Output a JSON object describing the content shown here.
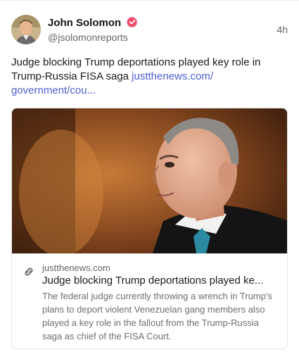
{
  "author": {
    "display_name": "John Solomon",
    "handle": "@jsolomonreports",
    "verified": true,
    "avatar_icon": "avatar-photo"
  },
  "post": {
    "timestamp": "4h",
    "text": "Judge blocking Trump deportations played key role in Trump-Russia FISA saga ",
    "link_text": "justthenews.com/​government/cou..."
  },
  "link_card": {
    "image_icon": "judge-photo",
    "domain": "justthenews.com",
    "title": "Judge blocking Trump deportations played ke...",
    "description": "The federal judge currently throwing a wrench in Trump's plans to deport violent Venezuelan gang members also played a key role in the fallout from the Trump-Russia saga as chief of the FISA Court."
  },
  "colors": {
    "link": "#4d5fd6",
    "verified_badge": "#ef4b6b",
    "muted_text": "#666666"
  }
}
